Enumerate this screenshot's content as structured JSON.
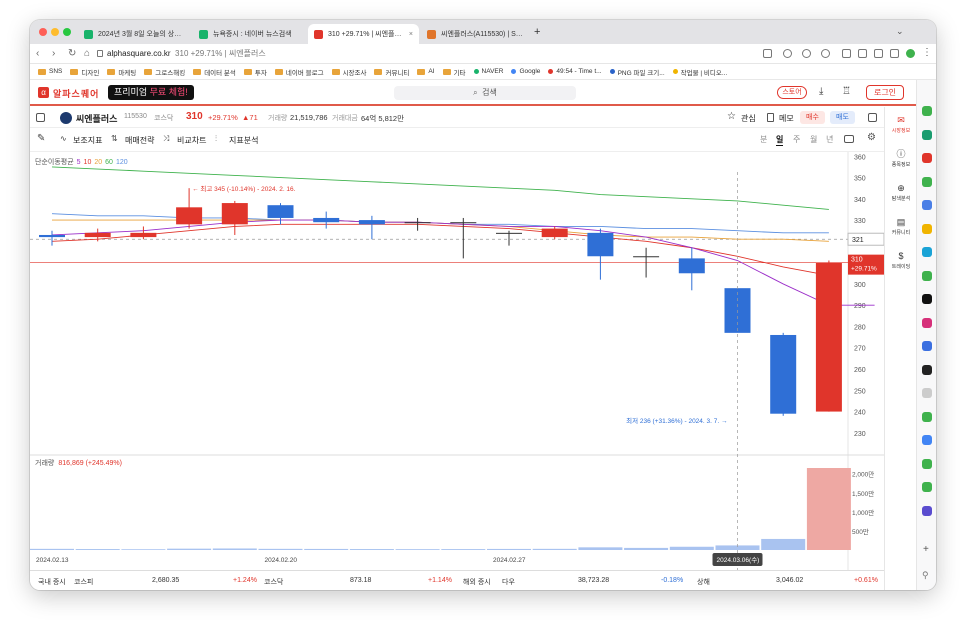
{
  "browser": {
    "tabs": [
      {
        "label": "2024년 3월 8일 오늘의 상한가 이슈",
        "favicon_color": "#19b36b",
        "active": false
      },
      {
        "label": "뉴욕증시 : 네이버 뉴스검색",
        "favicon_color": "#19b36b",
        "active": false
      },
      {
        "label": "310 +29.71% | 씨엔플러스",
        "favicon_color": "#e0352b",
        "active": true
      },
      {
        "label": "씨엔플러스(A115530) | Snapshot",
        "favicon_color": "#e0752b",
        "active": false
      }
    ],
    "new_tab": "+",
    "url_domain": "alphasquare.co.kr",
    "url_title": "310 +29.71% | 씨엔플러스",
    "bookmarks": [
      {
        "label": "SNS",
        "type": "folder"
      },
      {
        "label": "디자인",
        "type": "folder"
      },
      {
        "label": "마케팅",
        "type": "folder"
      },
      {
        "label": "그로스해킹",
        "type": "folder"
      },
      {
        "label": "데이터 분석",
        "type": "folder"
      },
      {
        "label": "투자",
        "type": "folder"
      },
      {
        "label": "네이버 블로그",
        "type": "folder"
      },
      {
        "label": "시장조사",
        "type": "folder"
      },
      {
        "label": "커뮤니티",
        "type": "folder"
      },
      {
        "label": "AI",
        "type": "folder"
      },
      {
        "label": "기타",
        "type": "folder"
      },
      {
        "label": "NAVER",
        "type": "site",
        "color": "#19b36b"
      },
      {
        "label": "Google",
        "type": "site",
        "color": "#4285f4"
      },
      {
        "label": "49:54 - Time t...",
        "type": "site",
        "color": "#e0352b"
      },
      {
        "label": "PNG 파일 크기...",
        "type": "site",
        "color": "#2a63c9"
      },
      {
        "label": "작업물 | 비디오...",
        "type": "site",
        "color": "#f0b400"
      }
    ]
  },
  "site": {
    "logo_mark": "α",
    "logo": "알파스퀘어",
    "promo_prefix": "프리미엄",
    "promo_accent": "무료 체험!",
    "search_placeholder": "검색",
    "store": "스토어",
    "login": "로그인"
  },
  "stock": {
    "name": "씨엔플러스",
    "code": "115530",
    "market": "코스닥",
    "price": "310",
    "change_pct": "+29.71%",
    "change_abs": "▲71",
    "volume_label": "거래량",
    "volume": "21,519,786",
    "value_label": "거래대금",
    "value": "64억 5,812만",
    "watch": "관심",
    "memo": "메모",
    "buy": "매수",
    "sell": "매도"
  },
  "toolbar": {
    "items": [
      "보조지표",
      "매매전략",
      "비교차트",
      "지표분석"
    ],
    "periods": [
      "분",
      "일",
      "주",
      "월",
      "년"
    ],
    "active_period": "일"
  },
  "chart_data": {
    "type": "candlestick",
    "ma_label": "단순이동평균",
    "ma_periods": [
      {
        "label": "5",
        "color": "#9b2fc9"
      },
      {
        "label": "10",
        "color": "#e0352b"
      },
      {
        "label": "20",
        "color": "#e8a23a"
      },
      {
        "label": "60",
        "color": "#3fb24d"
      },
      {
        "label": "120",
        "color": "#5b8fe0"
      }
    ],
    "y_ticks": [
      360,
      350,
      340,
      330,
      320,
      310,
      300,
      290,
      280,
      270,
      260,
      250,
      240,
      230
    ],
    "ylim": [
      221,
      362
    ],
    "candles": [
      {
        "o": 323,
        "h": 325,
        "l": 318,
        "c": 322
      },
      {
        "o": 322,
        "h": 326,
        "l": 320,
        "c": 324
      },
      {
        "o": 322,
        "h": 327,
        "l": 321,
        "c": 324
      },
      {
        "o": 328,
        "h": 345,
        "l": 326,
        "c": 336
      },
      {
        "o": 328,
        "h": 339,
        "l": 323,
        "c": 338
      },
      {
        "o": 337,
        "h": 338,
        "l": 328,
        "c": 331
      },
      {
        "o": 331,
        "h": 334,
        "l": 326,
        "c": 329
      },
      {
        "o": 330,
        "h": 332,
        "l": 321,
        "c": 328
      },
      {
        "o": 329,
        "h": 331,
        "l": 325,
        "c": 329
      },
      {
        "o": 329,
        "h": 331,
        "l": 312,
        "c": 329
      },
      {
        "o": 324,
        "h": 325,
        "l": 318,
        "c": 324
      },
      {
        "o": 322,
        "h": 327,
        "l": 321,
        "c": 326
      },
      {
        "o": 324,
        "h": 326,
        "l": 302,
        "c": 313
      },
      {
        "o": 313,
        "h": 317,
        "l": 303,
        "c": 313
      },
      {
        "o": 312,
        "h": 317,
        "l": 297,
        "c": 305
      },
      {
        "o": 298,
        "h": 298,
        "l": 278,
        "c": 277
      },
      {
        "o": 276,
        "h": 277,
        "l": 238,
        "c": 239
      },
      {
        "o": 240,
        "h": 311,
        "l": 240,
        "c": 310
      }
    ],
    "ma5": [
      323,
      324,
      325,
      327,
      329,
      330,
      330,
      329,
      329,
      328,
      327,
      327,
      325,
      322,
      317,
      311,
      300,
      290,
      290
    ],
    "ma10": [
      320,
      321,
      323,
      325,
      327,
      328,
      328,
      328,
      328,
      327,
      326,
      324,
      322,
      320,
      317,
      313,
      308,
      304
    ],
    "ma20": [
      330,
      330,
      330,
      330,
      330,
      330,
      330,
      329,
      329,
      328,
      327,
      325,
      323,
      322,
      322,
      321,
      321,
      320
    ],
    "ma60": [
      355,
      354,
      353,
      352,
      351,
      350,
      349,
      348,
      347,
      346,
      345,
      344,
      342,
      341,
      340,
      339,
      337,
      335
    ],
    "ma120": [
      333,
      332,
      332,
      331,
      331,
      330,
      330,
      329,
      329,
      328,
      328,
      327,
      327,
      326,
      326,
      325,
      324,
      324
    ],
    "high_annotation": "← 최고 345 (-10.14%) - 2024. 2. 16.",
    "low_annotation": "최저 236 (+31.36%) - 2024. 3. 7. →",
    "crosshair_value": "321",
    "price_tag": "310",
    "price_tag_pct": "+29.71%",
    "volume_label": "거래량",
    "volume_value": "816,869 (+245.49%)",
    "volume_ticks": [
      "2,000만",
      "1,500만",
      "1,000만",
      "500만"
    ],
    "volume_max": 2150,
    "volumes": [
      30,
      25,
      20,
      35,
      40,
      30,
      28,
      25,
      22,
      24,
      28,
      30,
      70,
      55,
      85,
      120,
      290,
      2150
    ],
    "volume_colors": [
      "down",
      "down",
      "down",
      "down",
      "down",
      "down",
      "down",
      "down",
      "down",
      "down",
      "down",
      "down",
      "down",
      "down",
      "down",
      "down",
      "down",
      "up"
    ],
    "x_labels": [
      "2024.02.13",
      "2024.02.20",
      "2024.02.27"
    ],
    "crosshair_date": "2024.03.06(수)"
  },
  "market_bar": {
    "domestic_label": "국내 증시",
    "overseas_label": "해외 증시",
    "items": [
      {
        "name": "코스피",
        "value": "2,680.35",
        "change": "+1.24%",
        "dir": "up"
      },
      {
        "name": "코스닥",
        "value": "873.18",
        "change": "+1.14%",
        "dir": "up"
      },
      {
        "name": "다우",
        "value": "38,723.28",
        "change": "-0.18%",
        "dir": "down"
      },
      {
        "name": "상해",
        "value": "3,046.02",
        "change": "+0.61%",
        "dir": "up"
      }
    ]
  },
  "right_panel": [
    {
      "label": "시장정보",
      "icon": "mail-icon",
      "color": "#e0352b"
    },
    {
      "label": "종목정보",
      "icon": "info-icon",
      "color": "#333"
    },
    {
      "label": "탐색분석",
      "icon": "zoom-icon",
      "color": "#333"
    },
    {
      "label": "커뮤니티",
      "icon": "chat-icon",
      "color": "#333"
    },
    {
      "label": "트레이딩",
      "icon": "dollar-icon",
      "color": "#333"
    }
  ],
  "extension_icons": [
    "#3fb24d",
    "#1a9c6f",
    "#e0352b",
    "#3fb24d",
    "#4a7fe6",
    "#f0b400",
    "#1aa3d6",
    "#3fb24d",
    "#111111",
    "#d6307a",
    "#3b6fe0",
    "#222222",
    "#cccccc",
    "#3fb24d",
    "#4285f4",
    "#3fb24d",
    "#3fb24d",
    "#5a4ccf"
  ]
}
